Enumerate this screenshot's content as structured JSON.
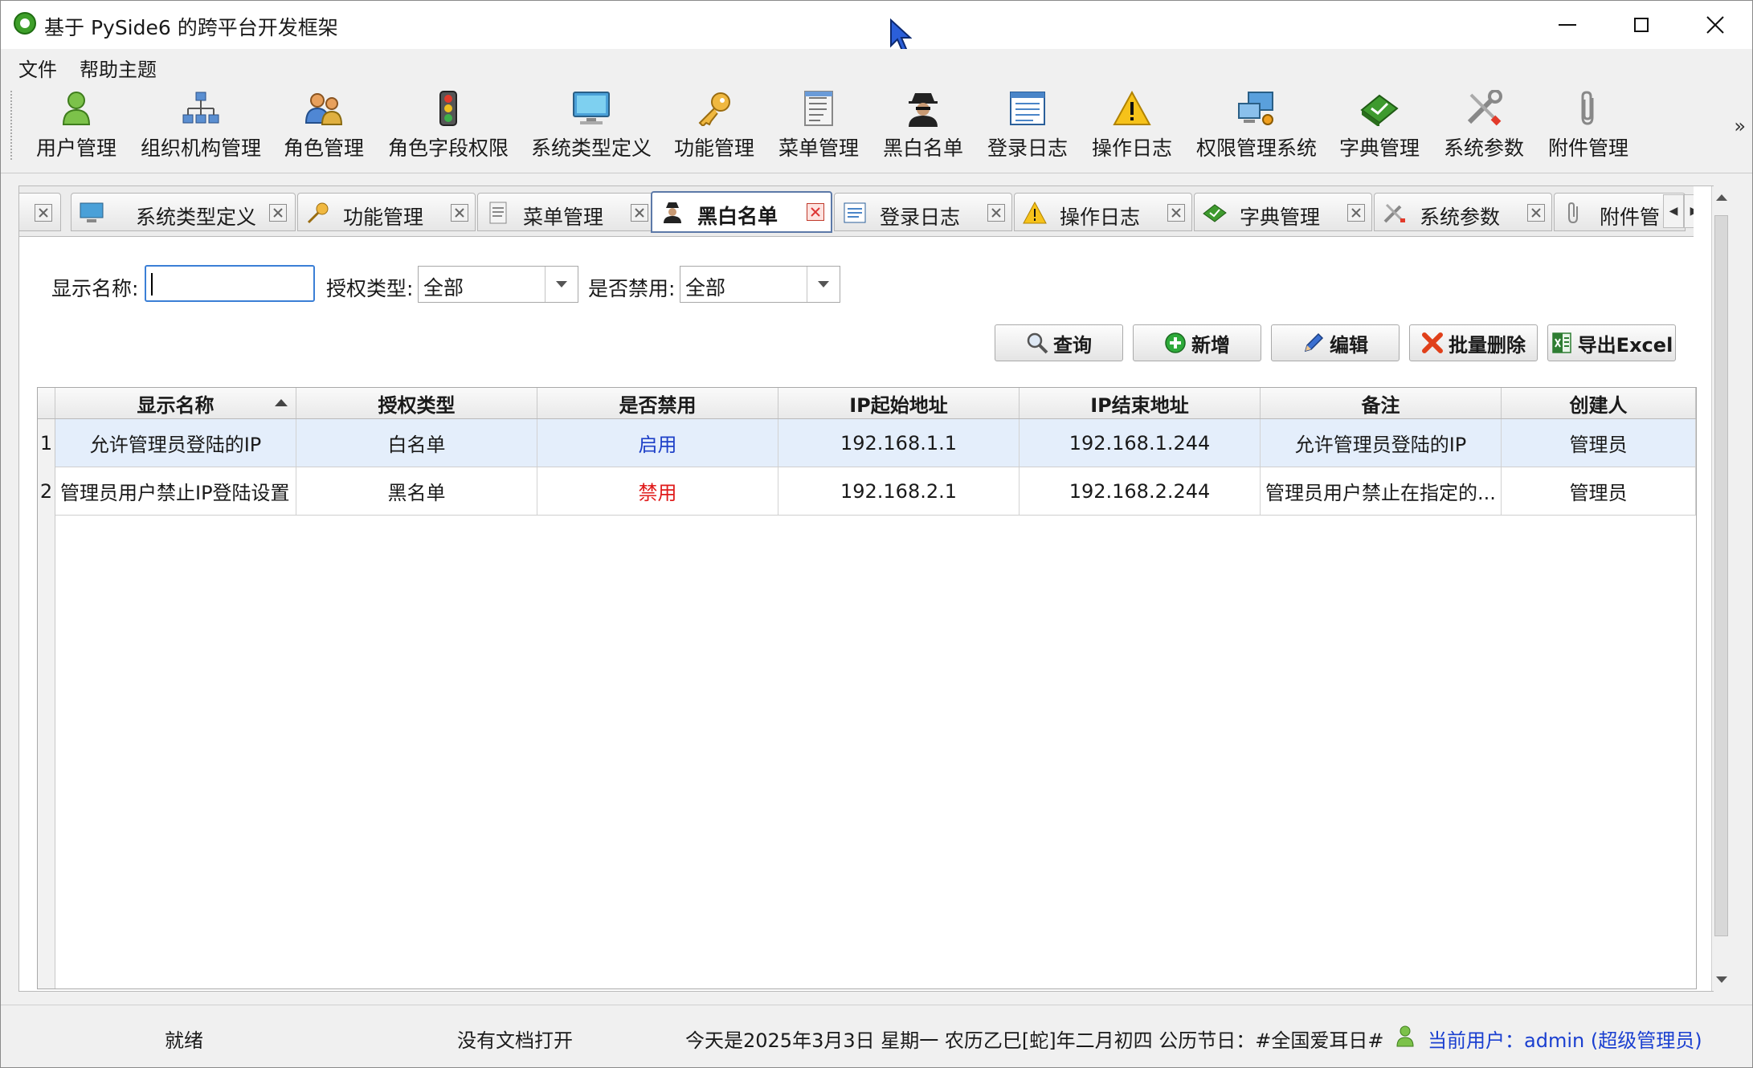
{
  "window": {
    "title": "基于 PySide6 的跨平台开发框架"
  },
  "menu": {
    "items": [
      "文件",
      "帮助主题"
    ]
  },
  "toolbar": {
    "items": [
      {
        "label": "用户管理",
        "icon": "user-icon"
      },
      {
        "label": "组织机构管理",
        "icon": "org-chart-icon"
      },
      {
        "label": "角色管理",
        "icon": "role-group-icon"
      },
      {
        "label": "角色字段权限",
        "icon": "traffic-light-icon"
      },
      {
        "label": "系统类型定义",
        "icon": "monitor-icon"
      },
      {
        "label": "功能管理",
        "icon": "key-icon"
      },
      {
        "label": "菜单管理",
        "icon": "menu-doc-icon"
      },
      {
        "label": "黑白名单",
        "icon": "spy-icon"
      },
      {
        "label": "登录日志",
        "icon": "log-list-icon"
      },
      {
        "label": "操作日志",
        "icon": "warning-icon"
      },
      {
        "label": "权限管理系统",
        "icon": "computer-network-icon"
      },
      {
        "label": "字典管理",
        "icon": "book-icon"
      },
      {
        "label": "系统参数",
        "icon": "tools-icon"
      },
      {
        "label": "附件管理",
        "icon": "paperclip-icon"
      }
    ],
    "more": "»"
  },
  "tabs": [
    {
      "label": "系统类型定义",
      "icon": "monitor-icon",
      "active": false
    },
    {
      "label": "功能管理",
      "icon": "key-icon",
      "active": false
    },
    {
      "label": "菜单管理",
      "icon": "menu-doc-icon",
      "active": false
    },
    {
      "label": "黑白名单",
      "icon": "spy-icon",
      "active": true
    },
    {
      "label": "登录日志",
      "icon": "log-list-icon",
      "active": false
    },
    {
      "label": "操作日志",
      "icon": "warning-icon",
      "active": false
    },
    {
      "label": "字典管理",
      "icon": "book-icon",
      "active": false
    },
    {
      "label": "系统参数",
      "icon": "tools-icon",
      "active": false
    },
    {
      "label": "附件管",
      "icon": "paperclip-icon",
      "active": false
    }
  ],
  "filters": {
    "display_name_label": "显示名称:",
    "display_name_value": "",
    "auth_type_label": "授权类型:",
    "auth_type_value": "全部",
    "disabled_label": "是否禁用:",
    "disabled_value": "全部"
  },
  "actions": {
    "query": "查询",
    "add": "新增",
    "edit": "编辑",
    "batch_delete": "批量删除",
    "export": "导出Excel"
  },
  "table": {
    "columns": [
      "显示名称",
      "授权类型",
      "是否禁用",
      "IP起始地址",
      "IP结束地址",
      "备注",
      "创建人"
    ],
    "rows": [
      {
        "index": "1",
        "name": "允许管理员登陆的IP",
        "auth_type": "白名单",
        "disabled": "启用",
        "ip_start": "192.168.1.1",
        "ip_end": "192.168.1.244",
        "note": "允许管理员登陆的IP",
        "creator": "管理员"
      },
      {
        "index": "2",
        "name": "管理员用户禁止IP登陆设置",
        "auth_type": "黑名单",
        "disabled": "禁用",
        "ip_start": "192.168.2.1",
        "ip_end": "192.168.2.244",
        "note": "管理员用户禁止在指定的...",
        "creator": "管理员"
      }
    ]
  },
  "status": {
    "ready": "就绪",
    "doc": "没有文档打开",
    "date": "今天是2025年3月3日 星期一 农历乙巳[蛇]年二月初四 公历节日：#全国爱耳日#",
    "user": "当前用户：admin (超级管理员)"
  },
  "colors": {
    "enabled_text": "#1e40c8",
    "disabled_text": "#e01b1b",
    "selection": "#e4eefb",
    "active_tab_border": "#5c79a8"
  }
}
